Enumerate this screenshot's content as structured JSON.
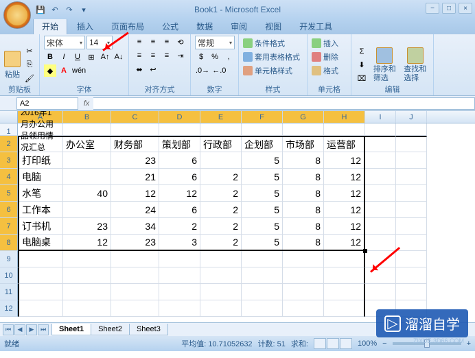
{
  "app": {
    "title": "Book1 - Microsoft Excel"
  },
  "tabs": {
    "home": "开始",
    "insert": "插入",
    "layout": "页面布局",
    "formula": "公式",
    "data": "数据",
    "review": "审阅",
    "view": "视图",
    "dev": "开发工具"
  },
  "ribbon": {
    "clipboard": {
      "paste": "粘贴",
      "label": "剪贴板"
    },
    "font": {
      "name": "宋体",
      "size": "14",
      "label": "字体"
    },
    "align": {
      "general": "常规",
      "label": "对齐方式"
    },
    "number": {
      "label": "数字"
    },
    "styles": {
      "cond": "条件格式",
      "table": "套用表格格式",
      "cell": "单元格样式",
      "label": "样式"
    },
    "cells": {
      "insert": "插入",
      "delete": "删除",
      "format": "格式",
      "label": "单元格"
    },
    "editing": {
      "sort": "排序和\n筛选",
      "find": "查找和\n选择",
      "label": "编辑"
    }
  },
  "namebox": "A2",
  "columns": [
    "A",
    "B",
    "C",
    "D",
    "E",
    "F",
    "G",
    "H",
    "I",
    "J"
  ],
  "rows": [
    "1",
    "2",
    "3",
    "4",
    "5",
    "6",
    "7",
    "8",
    "9",
    "10",
    "11",
    "12"
  ],
  "data": {
    "r1a": "2016年1月办公用品领用情况汇总",
    "headers": [
      "",
      "办公室",
      "财务部",
      "策划部",
      "行政部",
      "企划部",
      "市场部",
      "运营部"
    ],
    "body": [
      [
        "打印纸",
        "",
        "23",
        "6",
        "",
        "5",
        "8",
        "12"
      ],
      [
        "电脑",
        "",
        "21",
        "6",
        "2",
        "5",
        "8",
        "12"
      ],
      [
        "水笔",
        "40",
        "12",
        "12",
        "2",
        "5",
        "8",
        "12"
      ],
      [
        "工作本",
        "",
        "24",
        "6",
        "2",
        "5",
        "8",
        "12"
      ],
      [
        "订书机",
        "23",
        "34",
        "2",
        "2",
        "5",
        "8",
        "12"
      ],
      [
        "电脑桌",
        "12",
        "23",
        "3",
        "2",
        "5",
        "8",
        "12"
      ]
    ]
  },
  "sheets": {
    "s1": "Sheet1",
    "s2": "Sheet2",
    "s3": "Sheet3"
  },
  "status": {
    "ready": "就绪",
    "avg": "平均值: 10.71052632",
    "count": "计数: 51",
    "sum": "求和:",
    "zoom": "100%"
  },
  "watermark": {
    "text": "溜溜自学",
    "url": "ZIXUE.3D66.COM"
  }
}
